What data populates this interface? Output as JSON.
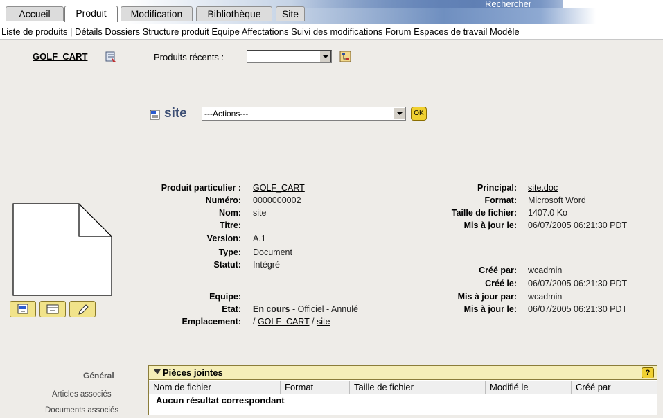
{
  "tabs": [
    "Accueil",
    "Produit",
    "Modification",
    "Bibliothèque",
    "Site"
  ],
  "active_tab": "Produit",
  "search_link": "Rechercher",
  "subnav": [
    "Liste de produits",
    "|",
    "Détails",
    "Dossiers",
    "Structure produit",
    "Equipe",
    "Affectations",
    "Suivi des modifications",
    "Forum",
    "Espaces de travail",
    "Modèle"
  ],
  "product": {
    "name": "GOLF_CART",
    "recent_label": "Produits récents :",
    "recent_value": ""
  },
  "object": {
    "title": "site",
    "actions_value": "---Actions---",
    "ok_label": "OK"
  },
  "details_left": [
    {
      "label": "Produit particulier :",
      "value": "GOLF_CART",
      "link": true
    },
    {
      "label": "Numéro:",
      "value": "0000000002"
    },
    {
      "label": "Nom:",
      "value": "site"
    },
    {
      "label": "Titre:",
      "value": ""
    },
    {
      "label": "Version:",
      "value": "A.1"
    },
    {
      "label": "Type:",
      "value": "Document"
    },
    {
      "label": "Statut:",
      "value": "Intégré"
    },
    {
      "label": "",
      "value": ""
    },
    {
      "label": "Equipe:",
      "value": ""
    },
    {
      "label": "Etat:",
      "value_bold": "En cours",
      "value_rest": " - Officiel - Annulé"
    },
    {
      "label": "Emplacement:",
      "value_prefix": "/ ",
      "value_link1": "GOLF_CART",
      "value_sep": " / ",
      "value_link2": "site"
    }
  ],
  "details_right": [
    {
      "label": "Principal:",
      "value": "site.doc",
      "link": true
    },
    {
      "label": "Format:",
      "value": "Microsoft Word"
    },
    {
      "label": "Taille de fichier:",
      "value": "1407.0 Ko"
    },
    {
      "label": "Mis à jour le:",
      "value": "06/07/2005 06:21:30 PDT"
    },
    {
      "label": "Créé par:",
      "value": "wcadmin"
    },
    {
      "label": "Créé le:",
      "value": "06/07/2005 06:21:30 PDT"
    },
    {
      "label": "Mis à jour par:",
      "value": "wcadmin"
    },
    {
      "label": "Mis à jour le:",
      "value": "06/07/2005 06:21:30 PDT"
    }
  ],
  "sidenav": {
    "general": "Général",
    "dash": "—",
    "items": [
      "Articles associés",
      "Documents associés"
    ]
  },
  "attachments": {
    "title": "Pièces jointes",
    "help": "?",
    "columns": [
      "Nom de fichier",
      "Format",
      "Taille de fichier",
      "Modifié le",
      "Créé par"
    ],
    "empty": "Aucun résultat correspondant"
  },
  "colors": {
    "accent": "#3d4f74",
    "panel_header": "#f5eeb8",
    "button_yellow": "#f0d030",
    "content_bg": "#eeece8"
  }
}
